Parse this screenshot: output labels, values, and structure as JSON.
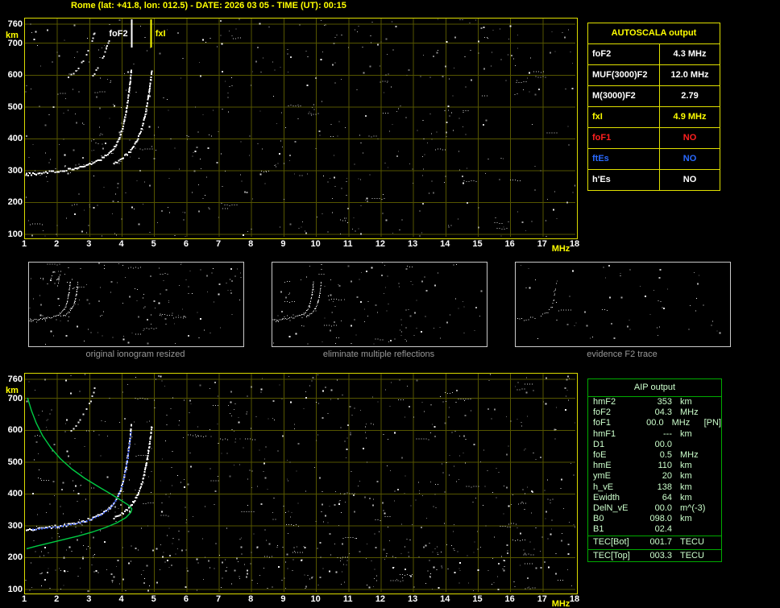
{
  "title": "Rome (lat: +41.8, lon: 012.5) - DATE: 2026 03 05 - TIME (UT): 00:15",
  "colors": {
    "accent_yellow": "#ffff00",
    "frame_yellow": "#dcdc00",
    "grid_olive": "#555500",
    "trace_white": "#ffffff",
    "profile_green": "#00cc44",
    "fitted_blue": "#4466ff",
    "no_red": "#ff2020",
    "es_blue": "#2a6aff",
    "caption_gray": "#989898",
    "aip_green": "#ccffcc",
    "aip_border": "#00aa00"
  },
  "autoscala_table": {
    "header": "AUTOSCALA output",
    "rows": [
      {
        "label": "foF2",
        "value": "4.3 MHz",
        "color": "#ffffff"
      },
      {
        "label": "MUF(3000)F2",
        "value": "12.0 MHz",
        "color": "#ffffff"
      },
      {
        "label": "M(3000)F2",
        "value": "2.79",
        "color": "#ffffff"
      },
      {
        "label": "fxI",
        "value": "4.9 MHz",
        "color": "#ffff00"
      },
      {
        "label": "foF1",
        "value": "NO",
        "color": "#ff2020"
      },
      {
        "label": "ftEs",
        "value": "NO",
        "color": "#2a6aff"
      },
      {
        "label": "h'Es",
        "value": "NO",
        "color": "#ffffff"
      }
    ]
  },
  "aip_table": {
    "header": "AIP output",
    "rows": [
      {
        "label": "hmF2",
        "value": "353",
        "unit": "km"
      },
      {
        "label": "foF2",
        "value": "04.3",
        "unit": "MHz"
      },
      {
        "label": "foF1",
        "value": "00.0",
        "unit": "MHz",
        "note": "[PN]"
      },
      {
        "label": "hmF1",
        "value": "---",
        "unit": "km"
      },
      {
        "label": "D1",
        "value": "00.0",
        "unit": ""
      },
      {
        "label": "foE",
        "value": "0.5",
        "unit": "MHz"
      },
      {
        "label": "hmE",
        "value": "110",
        "unit": "km"
      },
      {
        "label": "ymE",
        "value": "20",
        "unit": "km"
      },
      {
        "label": "h_vE",
        "value": "138",
        "unit": "km"
      },
      {
        "label": "Ewidth",
        "value": "64",
        "unit": "km"
      },
      {
        "label": "DelN_vE",
        "value": "00.0",
        "unit": "m^(-3)"
      },
      {
        "label": "B0",
        "value": "098.0",
        "unit": "km"
      },
      {
        "label": "B1",
        "value": "02.4",
        "unit": ""
      },
      {
        "label": "TEC[Bot]",
        "value": "001.7",
        "unit": "TECU",
        "sep_before": true
      },
      {
        "label": "TEC[Top]",
        "value": "003.3",
        "unit": "TECU",
        "sep_before": true
      }
    ]
  },
  "thumbnails": [
    {
      "caption": "original ionogram resized"
    },
    {
      "caption": "eliminate multiple reflections"
    },
    {
      "caption": "evidence F2 trace"
    }
  ],
  "chart_data": [
    {
      "id": "ionogram_autoscala",
      "type": "scatter",
      "title": "ionogram with AUTOSCALA markers",
      "xlabel": "MHz",
      "ylabel": "km",
      "xlim": [
        1,
        18
      ],
      "ylim": [
        100,
        760
      ],
      "xticks": [
        1,
        2,
        3,
        4,
        5,
        6,
        7,
        8,
        9,
        10,
        11,
        12,
        13,
        14,
        15,
        16,
        17,
        18
      ],
      "yticks": [
        760,
        700,
        600,
        500,
        400,
        300,
        200,
        100
      ],
      "grid": true,
      "points_format": "[frequency_MHz, virtual_height_km]",
      "markers": [
        {
          "name": "foF2-marker",
          "label": "foF2",
          "x_mhz": 4.3,
          "color": "#ffffff",
          "label_side": "left"
        },
        {
          "name": "fxI-marker",
          "label": "fxI",
          "x_mhz": 4.9,
          "color": "#ffff00",
          "label_side": "right"
        }
      ],
      "series": [
        {
          "name": "F2-trace-ordinary",
          "color": "#ffffff",
          "style": "trace",
          "points": [
            [
              1.05,
              287
            ],
            [
              1.35,
              290
            ],
            [
              1.7,
              294
            ],
            [
              2.05,
              298
            ],
            [
              2.4,
              304
            ],
            [
              2.75,
              312
            ],
            [
              3.05,
              322
            ],
            [
              3.35,
              336
            ],
            [
              3.6,
              354
            ],
            [
              3.8,
              378
            ],
            [
              3.95,
              408
            ],
            [
              4.05,
              445
            ],
            [
              4.13,
              487
            ],
            [
              4.19,
              528
            ],
            [
              4.24,
              566
            ],
            [
              4.27,
              600
            ],
            [
              4.29,
              622
            ]
          ]
        },
        {
          "name": "F2-trace-extraordinary",
          "color": "#ffffff",
          "style": "trace",
          "points": [
            [
              3.75,
              322
            ],
            [
              4.0,
              338
            ],
            [
              4.25,
              360
            ],
            [
              4.45,
              390
            ],
            [
              4.6,
              428
            ],
            [
              4.7,
              468
            ],
            [
              4.78,
              510
            ],
            [
              4.84,
              550
            ],
            [
              4.89,
              588
            ],
            [
              4.92,
              618
            ]
          ]
        },
        {
          "name": "second-hop-echo-1",
          "color": "#ffffff",
          "style": "sparse",
          "points": [
            [
              2.35,
              592
            ],
            [
              2.5,
              606
            ],
            [
              2.65,
              624
            ],
            [
              2.8,
              646
            ],
            [
              2.95,
              674
            ],
            [
              3.08,
              706
            ],
            [
              3.18,
              740
            ]
          ]
        },
        {
          "name": "second-hop-echo-2",
          "color": "#ffffff",
          "style": "sparse",
          "points": [
            [
              3.1,
              600
            ],
            [
              3.25,
              622
            ],
            [
              3.4,
              650
            ],
            [
              3.52,
              682
            ],
            [
              3.62,
              716
            ]
          ]
        }
      ]
    },
    {
      "id": "ionogram_aip_profile",
      "type": "scatter",
      "title": "ionogram with AIP electron density profile",
      "xlabel": "MHz",
      "ylabel": "km",
      "xlim": [
        1,
        18
      ],
      "ylim": [
        100,
        760
      ],
      "xticks": [
        1,
        2,
        3,
        4,
        5,
        6,
        7,
        8,
        9,
        10,
        11,
        12,
        13,
        14,
        15,
        16,
        17,
        18
      ],
      "yticks": [
        760,
        700,
        600,
        500,
        400,
        300,
        200,
        100
      ],
      "grid": true,
      "points_format": "[frequency_MHz, height_km]",
      "markers": [],
      "series": [
        {
          "name": "F2-trace-ordinary",
          "color": "#ffffff",
          "style": "trace",
          "points": [
            [
              1.05,
              287
            ],
            [
              1.35,
              290
            ],
            [
              1.7,
              294
            ],
            [
              2.05,
              298
            ],
            [
              2.4,
              304
            ],
            [
              2.75,
              312
            ],
            [
              3.05,
              322
            ],
            [
              3.35,
              336
            ],
            [
              3.6,
              354
            ],
            [
              3.8,
              378
            ],
            [
              3.95,
              408
            ],
            [
              4.05,
              445
            ],
            [
              4.13,
              487
            ],
            [
              4.19,
              528
            ],
            [
              4.24,
              566
            ],
            [
              4.27,
              600
            ],
            [
              4.29,
              622
            ]
          ]
        },
        {
          "name": "F2-trace-extraordinary",
          "color": "#ffffff",
          "style": "trace",
          "points": [
            [
              3.75,
              322
            ],
            [
              4.0,
              338
            ],
            [
              4.25,
              360
            ],
            [
              4.45,
              390
            ],
            [
              4.6,
              428
            ],
            [
              4.7,
              468
            ],
            [
              4.78,
              510
            ],
            [
              4.84,
              550
            ],
            [
              4.89,
              588
            ],
            [
              4.92,
              618
            ]
          ]
        },
        {
          "name": "second-hop-echo-1",
          "color": "#ffffff",
          "style": "sparse",
          "points": [
            [
              2.35,
              592
            ],
            [
              2.5,
              606
            ],
            [
              2.65,
              624
            ],
            [
              2.8,
              646
            ],
            [
              2.95,
              674
            ],
            [
              3.08,
              706
            ],
            [
              3.18,
              740
            ]
          ]
        },
        {
          "name": "autoscala-restored-trace",
          "color": "#4466ff",
          "style": "dotted",
          "points": [
            [
              1.25,
              288
            ],
            [
              1.7,
              293
            ],
            [
              2.15,
              299
            ],
            [
              2.6,
              307
            ],
            [
              3.0,
              318
            ],
            [
              3.35,
              334
            ],
            [
              3.65,
              357
            ],
            [
              3.85,
              386
            ],
            [
              4.0,
              424
            ],
            [
              4.1,
              468
            ],
            [
              4.18,
              514
            ],
            [
              4.24,
              560
            ],
            [
              4.28,
              603
            ]
          ]
        },
        {
          "name": "electron-density-profile",
          "color": "#00cc44",
          "style": "line",
          "points": [
            [
              1.08,
              702
            ],
            [
              1.2,
              662
            ],
            [
              1.35,
              622
            ],
            [
              1.55,
              582
            ],
            [
              1.8,
              545
            ],
            [
              2.1,
              510
            ],
            [
              2.45,
              478
            ],
            [
              2.85,
              449
            ],
            [
              3.25,
              424
            ],
            [
              3.65,
              400
            ],
            [
              3.95,
              381
            ],
            [
              4.18,
              366
            ],
            [
              4.3,
              353
            ],
            [
              4.27,
              342
            ],
            [
              4.12,
              326
            ],
            [
              3.85,
              310
            ],
            [
              3.5,
              295
            ],
            [
              3.1,
              281
            ],
            [
              2.65,
              268
            ],
            [
              2.2,
              257
            ],
            [
              1.75,
              246
            ],
            [
              1.35,
              236
            ],
            [
              1.05,
              228
            ]
          ]
        }
      ]
    }
  ]
}
